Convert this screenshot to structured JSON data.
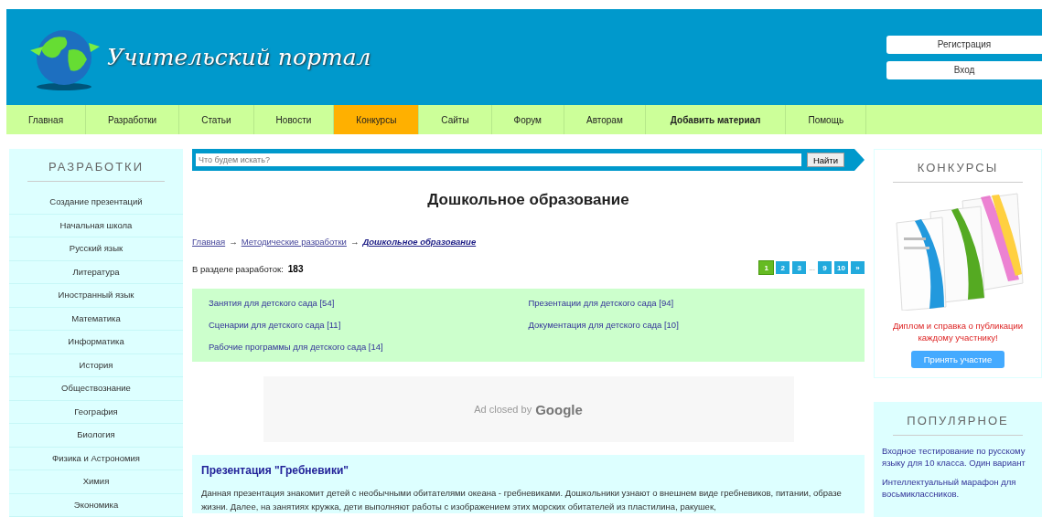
{
  "header": {
    "logo_text": "Учительский портал",
    "buttons": [
      "Регистрация",
      "Вход"
    ]
  },
  "nav": [
    {
      "label": "Главная",
      "selected": false,
      "kind": "link"
    },
    {
      "label": "Разработки",
      "selected": false,
      "kind": "link"
    },
    {
      "label": "Статьи",
      "selected": false,
      "kind": "link"
    },
    {
      "label": "Новости",
      "selected": false,
      "kind": "link"
    },
    {
      "label": "Конкурсы",
      "selected": true,
      "kind": "link"
    },
    {
      "label": "Сайты",
      "selected": false,
      "kind": "link"
    },
    {
      "label": "Форум",
      "selected": false,
      "kind": "link"
    },
    {
      "label": "Авторам",
      "selected": false,
      "kind": "link"
    },
    {
      "label": "Добавить материал",
      "selected": false,
      "kind": "action"
    },
    {
      "label": "Помощь",
      "selected": false,
      "kind": "link"
    }
  ],
  "sidebar": {
    "title": "РАЗРАБОТКИ",
    "items": [
      "Создание презентаций",
      "Начальная школа",
      "Русский язык",
      "Литература",
      "Иностранный язык",
      "Математика",
      "Информатика",
      "История",
      "Обществознание",
      "География",
      "Биология",
      "Физика и Астрономия",
      "Химия",
      "Экономика"
    ]
  },
  "search": {
    "placeholder": "Что будем искать?",
    "button": "Найти"
  },
  "page_title": "Дошкольное образование",
  "breadcrumbs": [
    {
      "label": "Главная",
      "current": false
    },
    {
      "label": "Методические разработки",
      "current": false
    },
    {
      "label": "Дошкольное образование",
      "current": true
    }
  ],
  "breadcrumb_separator": "→",
  "count": {
    "label": "В разделе разработок:",
    "value": "183"
  },
  "pagination": [
    {
      "label": "1",
      "kind": "page",
      "selected": true
    },
    {
      "label": "2",
      "kind": "page",
      "selected": false
    },
    {
      "label": "3",
      "kind": "page",
      "selected": false
    },
    {
      "label": "...",
      "kind": "gap"
    },
    {
      "label": "9",
      "kind": "page",
      "selected": false
    },
    {
      "label": "10",
      "kind": "page",
      "selected": false
    },
    {
      "label": "»",
      "kind": "page",
      "selected": false
    }
  ],
  "subsections": [
    "Занятия для детского сада [54]",
    "Презентации для детского сада [94]",
    "Сценарии для детского сада [11]",
    "Документация для детского сада [10]",
    "Рабочие программы для детского сада [14]"
  ],
  "ad": {
    "text": "Ad closed by",
    "brand": "Google"
  },
  "article": {
    "title": "Презентация \"Гребневики\"",
    "text": "Данная презентация знакомит детей с необычными обитателями океана - гребневиками. Дошкольники узнают о внешнем виде гребневиков, питании, образе жизни. Далее, на занятиях кружка, дети выполняют работы с изображением этих морских обитателей из пластилина, ракушек,"
  },
  "contests": {
    "title": "КОНКУРСЫ",
    "text": "Диплом и справка о публикации каждому участнику!",
    "button": "Принять участие"
  },
  "popular": {
    "title": "ПОПУЛЯРНОЕ",
    "items": [
      "Входное тестирование по русскому языку для 10 класса. Один вариант",
      "Интеллектуальный марафон для восьмиклассников."
    ]
  }
}
